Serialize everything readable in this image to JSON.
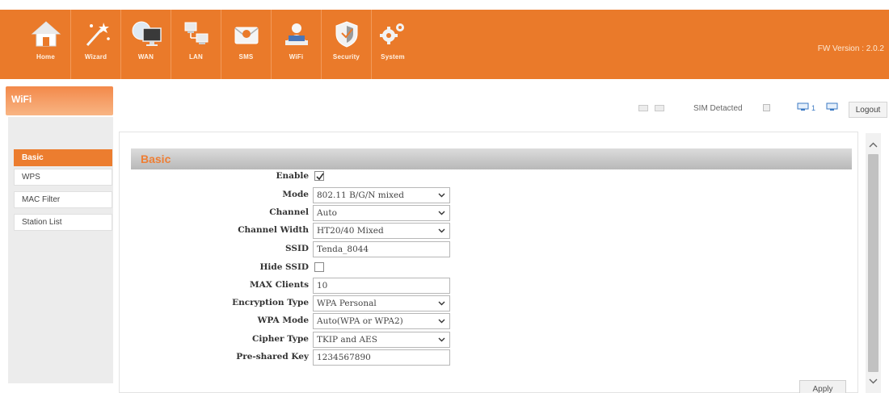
{
  "nav": {
    "items": [
      {
        "label": "Home",
        "icon": "home-icon"
      },
      {
        "label": "Wizard",
        "icon": "wizard-wand-icon"
      },
      {
        "label": "WAN",
        "icon": "globe-monitor-icon"
      },
      {
        "label": "LAN",
        "icon": "lan-computers-icon"
      },
      {
        "label": "SMS",
        "icon": "envelope-icon"
      },
      {
        "label": "WiFi",
        "icon": "wifi-user-icon"
      },
      {
        "label": "Security",
        "icon": "shield-icon"
      },
      {
        "label": "System",
        "icon": "gears-icon"
      }
    ],
    "fw_version": "FW Version : 2.0.2"
  },
  "section": {
    "title": "WiFi"
  },
  "status": {
    "sim_text": "SIM Detacted",
    "client_count": "1",
    "logout_label": "Logout"
  },
  "sidebar": {
    "items": [
      {
        "label": "Basic",
        "active": true
      },
      {
        "label": "WPS",
        "active": false
      },
      {
        "label": "MAC Filter",
        "active": false
      },
      {
        "label": "Station List",
        "active": false
      }
    ]
  },
  "panel": {
    "title": "Basic",
    "apply_label": "Apply"
  },
  "form": {
    "enable": {
      "label": "Enable",
      "checked": true
    },
    "mode": {
      "label": "Mode",
      "value": "802.11 B/G/N mixed"
    },
    "channel": {
      "label": "Channel",
      "value": "Auto"
    },
    "channel_width": {
      "label": "Channel Width",
      "value": "HT20/40 Mixed"
    },
    "ssid": {
      "label": "SSID",
      "value": "Tenda_8044"
    },
    "hide_ssid": {
      "label": "Hide SSID",
      "checked": false
    },
    "max_clients": {
      "label": "MAX Clients",
      "value": "10"
    },
    "encryption_type": {
      "label": "Encryption Type",
      "value": "WPA Personal"
    },
    "wpa_mode": {
      "label": "WPA Mode",
      "value": "Auto(WPA or WPA2)"
    },
    "cipher_type": {
      "label": "Cipher Type",
      "value": "TKIP and AES"
    },
    "psk": {
      "label": "Pre-shared Key",
      "value": "1234567890"
    }
  },
  "colors": {
    "brand_orange": "#ea7a2a",
    "active_orange": "#ec7d2f",
    "title_orange": "#ee7e34"
  }
}
